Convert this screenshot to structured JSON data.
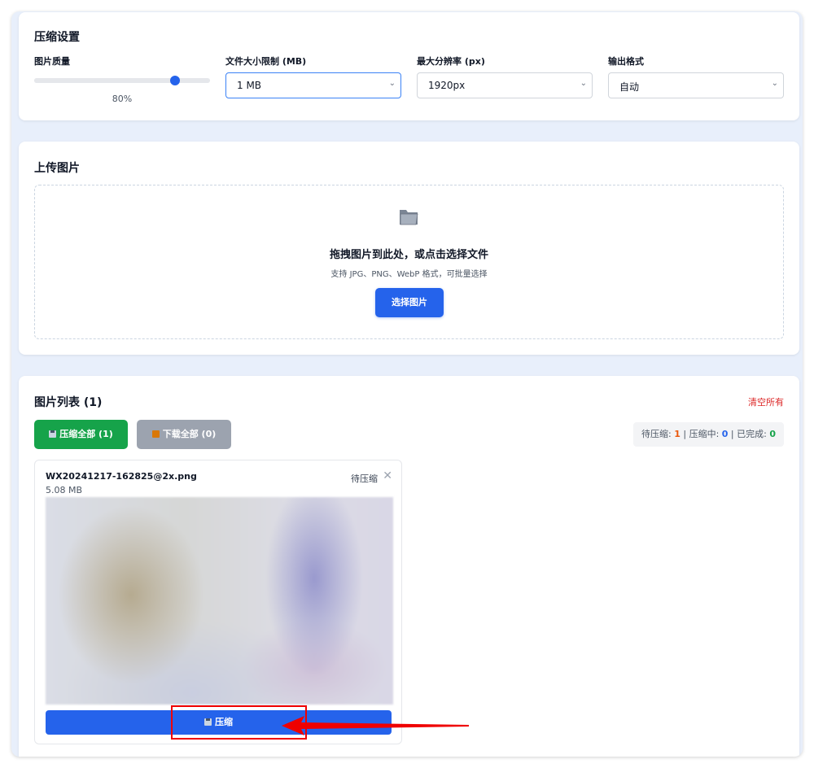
{
  "settings": {
    "title": "压缩设置",
    "quality": {
      "label": "图片质量",
      "value": 80,
      "display": "80%"
    },
    "size_limit": {
      "label": "文件大小限制 (MB)",
      "value": "1 MB"
    },
    "max_resolution": {
      "label": "最大分辨率 (px)",
      "value": "1920px"
    },
    "output_format": {
      "label": "输出格式",
      "value": "自动"
    }
  },
  "upload": {
    "title": "上传图片",
    "icon": "folder-icon",
    "main_text": "拖拽图片到此处，或点击选择文件",
    "sub_text": "支持 JPG、PNG、WebP 格式，可批量选择",
    "button": "选择图片"
  },
  "list": {
    "title": "图片列表 (1)",
    "clear_all": "清空所有",
    "compress_all": "压缩全部 (1)",
    "download_all": "下载全部 (0)",
    "stats": {
      "pending_label": "待压缩: ",
      "pending": "1",
      "working_label": "压缩中: ",
      "working": "0",
      "done_label": "已完成: ",
      "done": "0",
      "sep": " | "
    },
    "files": [
      {
        "name": "WX20241217-162825@2x.png",
        "size": "5.08 MB",
        "status": "待压缩",
        "compress_button": "压缩"
      }
    ]
  },
  "colors": {
    "primary": "#2563eb",
    "success": "#16a34a",
    "muted": "#9ca3af",
    "danger": "#dc2626",
    "annotation": "#ef0000"
  }
}
